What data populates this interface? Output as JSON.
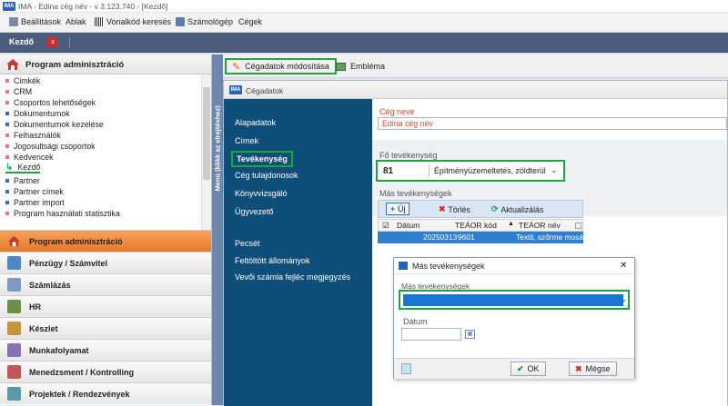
{
  "window": {
    "app_logo": "IMA",
    "title": "IMA - Edina cég név - v 3.123.740 - [Kezdő]"
  },
  "menubar": {
    "items": [
      "Beállítások",
      "Ablak",
      "Vonalkód keresés",
      "Számológép",
      "Cégek"
    ]
  },
  "doc_tab": {
    "label": "Kezdő",
    "close": "x"
  },
  "left_panel": {
    "header": "Program adminisztráció",
    "items": [
      "Cimkék",
      "CRM",
      "Csoportos lehetőségek",
      "Dokumentumok",
      "Dokumentumok kezelése",
      "Felhasználók",
      "Jogosultsági csoportok",
      "Kedvencek",
      "Kezdő",
      "Partner",
      "Partner címek",
      "Partner import",
      "Program használati statisztika"
    ],
    "vertical_label": "Menü (klikk az elrejtéshez)"
  },
  "modules": [
    "Program adminisztráció",
    "Pénzügy / Számvitel",
    "Számlázás",
    "HR",
    "Készlet",
    "Munkafolyamat",
    "Menedzsment / Kontrolling",
    "Projektek / Rendezvények"
  ],
  "toolbar": {
    "edit_label": "Cégadatok módosítása",
    "emblem_label": "Embléma"
  },
  "form": {
    "title": "Cégadatok",
    "nav": [
      "Alapadatok",
      "Címek",
      "Tevékenység",
      "Cég tulajdonosok",
      "Könyvvizsgáló",
      "Ügyvezető",
      "Pecsét",
      "Feltöltött állományok",
      "Vevői számla fejléc megjegyzés"
    ],
    "company_name_label": "Cég neve",
    "company_name_value": "Edina cég név",
    "main_activity_label": "Fő tevékenység",
    "main_activity_code": "81",
    "main_activity_name": "Építményüzemeltetés, zöldterül",
    "other_activities_label": "Más tevékenységek",
    "buttons": {
      "new": "Új",
      "delete": "Törlés",
      "refresh": "Aktualizálás"
    },
    "grid": {
      "columns": [
        "Dátum",
        "TEÁOR kód",
        "TEÁOR név"
      ],
      "rows": [
        {
          "date": "20250313",
          "code": "9601",
          "name": "Textil, szőrme mosá"
        }
      ]
    }
  },
  "dialog": {
    "title": "Más tevékenységek",
    "close": "✕",
    "field_label": "Más tevékenységek",
    "date_label": "Dátum",
    "ok": "OK",
    "cancel": "Mégse"
  },
  "colors": {
    "accent_green": "#1ea541",
    "nav_blue": "#0f4e78",
    "selection_blue": "#2f7fcf",
    "active_module_orange": "#e8782b"
  }
}
